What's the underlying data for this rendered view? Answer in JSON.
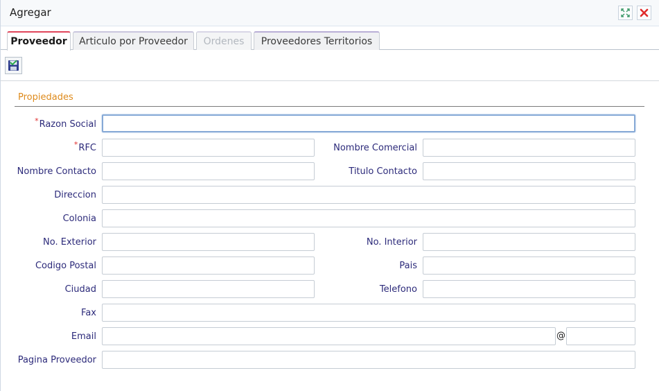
{
  "window": {
    "title": "Agregar"
  },
  "tabs": [
    {
      "label": "Proveedor",
      "state": "active"
    },
    {
      "label": "Articulo por Proveedor",
      "state": "normal"
    },
    {
      "label": "Ordenes",
      "state": "disabled"
    },
    {
      "label": "Proveedores Territorios",
      "state": "normal"
    }
  ],
  "toolbar": {
    "save_icon": "save-check-icon"
  },
  "form": {
    "section_title": "Propiedades",
    "required_mark": "*",
    "fields": {
      "razon_social": {
        "label": "Razon Social",
        "value": "",
        "required": true
      },
      "rfc": {
        "label": "RFC",
        "value": "",
        "required": true
      },
      "nombre_comercial": {
        "label": "Nombre Comercial",
        "value": ""
      },
      "nombre_contacto": {
        "label": "Nombre Contacto",
        "value": ""
      },
      "titulo_contacto": {
        "label": "Titulo Contacto",
        "value": ""
      },
      "direccion": {
        "label": "Direccion",
        "value": ""
      },
      "colonia": {
        "label": "Colonia",
        "value": ""
      },
      "no_exterior": {
        "label": "No. Exterior",
        "value": ""
      },
      "no_interior": {
        "label": "No. Interior",
        "value": ""
      },
      "codigo_postal": {
        "label": "Codigo Postal",
        "value": ""
      },
      "pais": {
        "label": "Pais",
        "value": ""
      },
      "ciudad": {
        "label": "Ciudad",
        "value": ""
      },
      "telefono": {
        "label": "Telefono",
        "value": ""
      },
      "fax": {
        "label": "Fax",
        "value": ""
      },
      "email": {
        "label": "Email",
        "value": "",
        "separator": "@",
        "domain_value": ""
      },
      "pagina_proveedor": {
        "label": "Pagina Proveedor",
        "value": ""
      }
    }
  },
  "colors": {
    "active_tab_accent": "#e0455a",
    "section_title": "#de8a1b",
    "label": "#2c2a7a",
    "required": "#e03030",
    "focus_border": "#86a9d6"
  }
}
